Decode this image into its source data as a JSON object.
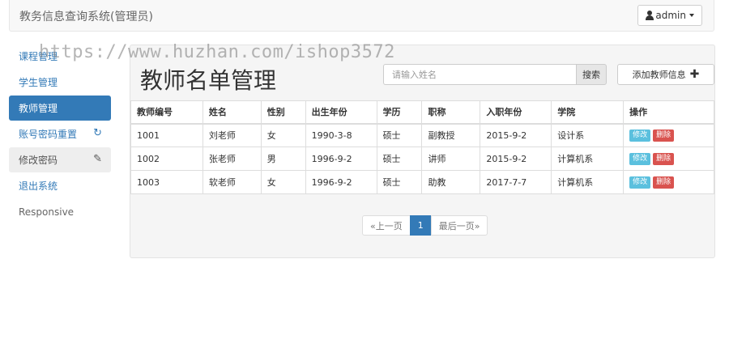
{
  "navbar": {
    "brand": "教务信息查询系统(管理员)",
    "user": "admin"
  },
  "watermark": "https://www.huzhan.com/ishop3572",
  "sidebar": {
    "items": [
      {
        "label": "课程管理"
      },
      {
        "label": "学生管理"
      },
      {
        "label": "教师管理"
      },
      {
        "label": "账号密码重置",
        "icon": "↻"
      },
      {
        "label": "修改密码",
        "icon": "✎"
      },
      {
        "label": "退出系统"
      },
      {
        "label": "Responsive"
      }
    ]
  },
  "main": {
    "title": "教师名单管理",
    "search_placeholder": "请输入姓名",
    "search_label": "搜索",
    "add_label": "添加教师信息"
  },
  "table": {
    "headers": [
      "教师编号",
      "姓名",
      "性别",
      "出生年份",
      "学历",
      "职称",
      "入职年份",
      "学院",
      "操作"
    ],
    "rows": [
      {
        "id": "1001",
        "name": "刘老师",
        "gender": "女",
        "birth": "1990-3-8",
        "edu": "硕士",
        "title": "副教授",
        "join": "2015-9-2",
        "college": "设计系"
      },
      {
        "id": "1002",
        "name": "张老师",
        "gender": "男",
        "birth": "1996-9-2",
        "edu": "硕士",
        "title": "讲师",
        "join": "2015-9-2",
        "college": "计算机系"
      },
      {
        "id": "1003",
        "name": "软老师",
        "gender": "女",
        "birth": "1996-9-2",
        "edu": "硕士",
        "title": "助教",
        "join": "2017-7-7",
        "college": "计算机系"
      }
    ],
    "edit_label": "修改",
    "delete_label": "删除"
  },
  "pager": {
    "prev": "«上一页",
    "current": "1",
    "last": "最后一页»"
  },
  "colors": {
    "primary": "#337ab7",
    "info": "#5bc0de",
    "danger": "#d9534f"
  }
}
